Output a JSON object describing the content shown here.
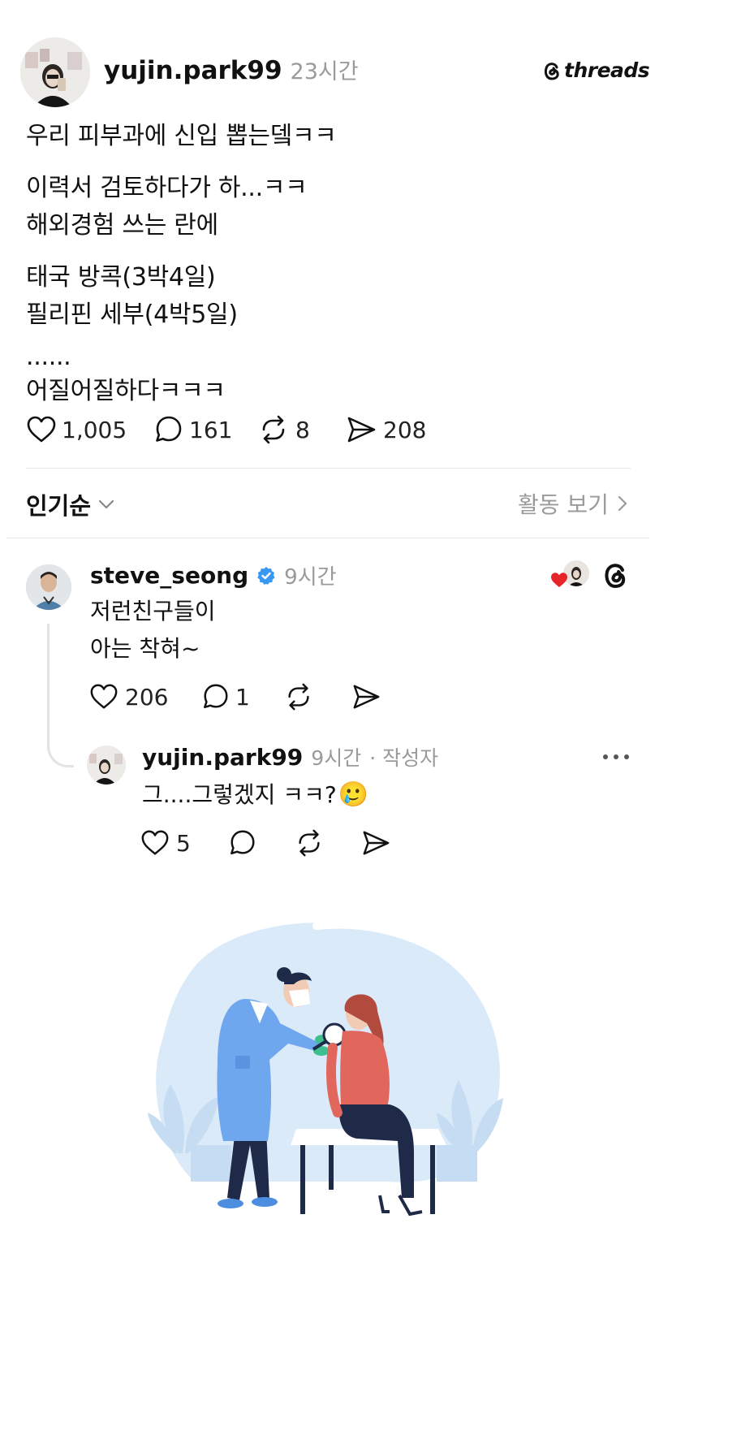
{
  "post": {
    "username": "yujin.park99",
    "time": "23시간",
    "brand": "threads",
    "lines": [
      "우리 피부과에 신입 뽑는뎈ㅋㅋ",
      "이력서 검토하다가 하...ㅋㅋ",
      "해외경험 쓰는 란에",
      "태국 방콕(3박4일)",
      "필리핀 세부(4박5일)",
      "......",
      "어질어질하다ㅋㅋㅋ"
    ],
    "likes": "1,005",
    "comments": "161",
    "reposts": "8",
    "shares": "208"
  },
  "replies_bar": {
    "sort_label": "인기순",
    "activity_label": "활동 보기"
  },
  "comment": {
    "username": "steve_seong",
    "time": "9시간",
    "line1": "저런친구들이",
    "line2": "아는 착혀~",
    "likes": "206",
    "replies": "1"
  },
  "reply": {
    "username": "yujin.park99",
    "time": "9시간",
    "author_tag": "· 작성자",
    "text": "그....그렇겠지 ㅋㅋ?",
    "emoji": "🥲",
    "likes": "5"
  },
  "colors": {
    "verified": "#3897f0",
    "heart": "#e5252a",
    "muted": "#9a9a9a",
    "illustration_blob": "#dbeaf9",
    "doctor_coat": "#6fa7ef",
    "patient_shirt": "#e1675c",
    "pants": "#1f2a48"
  }
}
